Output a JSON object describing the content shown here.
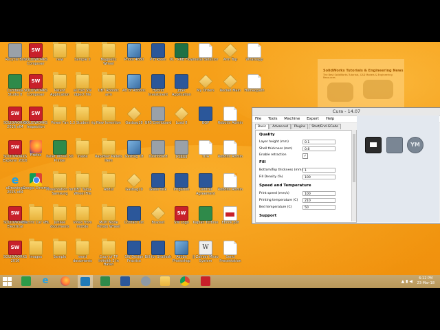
{
  "desktop": {
    "icons": [
      {
        "label": "Recycle Bin",
        "type": "gray"
      },
      {
        "label": "SOLIDWORKS Composer",
        "type": "sw"
      },
      {
        "label": "new",
        "type": "folder"
      },
      {
        "label": "Sample 2",
        "type": "folder"
      },
      {
        "label": "Magnetic Wheel",
        "type": "folder"
      },
      {
        "label": "Photo 4830",
        "type": "img"
      },
      {
        "label": "P 8 Room",
        "type": "word"
      },
      {
        "label": "01 - RKB Flow",
        "type": "excel"
      },
      {
        "label": "metal detector",
        "type": "doc"
      },
      {
        "label": "Arm Top",
        "type": "box"
      },
      {
        "label": "Whatsapp",
        "type": "doc"
      },
      {
        "label": "Camtasia Studio 8",
        "type": "green"
      },
      {
        "label": "SOLIDWORKS Composer",
        "type": "sw"
      },
      {
        "label": "Patent Application",
        "type": "folder"
      },
      {
        "label": "all fold SW object file",
        "type": "folder"
      },
      {
        "label": "UBT Robotic arm",
        "type": "folder"
      },
      {
        "label": "Att of Robotic",
        "type": "img"
      },
      {
        "label": "Hybrid Investment",
        "type": "word"
      },
      {
        "label": "JBSP Application",
        "type": "word"
      },
      {
        "label": "My Orders",
        "type": "box"
      },
      {
        "label": "Rocket Main",
        "type": "box"
      },
      {
        "label": "Homeopath",
        "type": "doc"
      },
      {
        "label": "SOLIDWORKS 2016 x64",
        "type": "sw"
      },
      {
        "label": "SOLIDWORKS Inspection",
        "type": "sw"
      },
      {
        "label": "Power Fan",
        "type": "folder"
      },
      {
        "label": "1.3 Student rig",
        "type": "folder"
      },
      {
        "label": "New Invention",
        "type": "folder"
      },
      {
        "label": "Gasbag18",
        "type": "box"
      },
      {
        "label": "GPS Dashboard",
        "type": "gray"
      },
      {
        "label": "Load 8",
        "type": "box"
      },
      {
        "label": "BGP",
        "type": "word"
      },
      {
        "label": "Robotic Admin",
        "type": "doc"
      },
      {
        "label": "SOLIDWORKS Explorer 2016",
        "type": "sw"
      },
      {
        "label": "Firefox",
        "type": "firefox"
      },
      {
        "label": "Pallet Wheel 3D Printer",
        "type": "green"
      },
      {
        "label": "Inside",
        "type": "folder"
      },
      {
        "label": "Rapidser Pallets Item",
        "type": "folder"
      },
      {
        "label": "Gasbag 18",
        "type": "img"
      },
      {
        "label": "Dashboard",
        "type": "gray"
      },
      {
        "label": "jkjjjjjjjjj",
        "type": "gray"
      },
      {
        "label": "TDA",
        "type": "doc"
      },
      {
        "label": "Robotic Admin",
        "type": "doc"
      },
      {
        "label": "eDrawings 2016 x64",
        "type": "ie-e"
      },
      {
        "label": "Google Chrome",
        "type": "chrome"
      },
      {
        "label": "Presentation for Samsung",
        "type": "folder"
      },
      {
        "label": "DBT Taiba Wheel File",
        "type": "folder"
      },
      {
        "label": "Abdul",
        "type": "folder"
      },
      {
        "label": "Gasbag19",
        "type": "box"
      },
      {
        "label": "Glass disk",
        "type": "word"
      },
      {
        "label": "Irrigation",
        "type": "word"
      },
      {
        "label": "Central Agreement",
        "type": "word"
      },
      {
        "label": "Robotic Admin",
        "type": "doc"
      },
      {
        "label": "SOLIDWORKS Electrical",
        "type": "sw"
      },
      {
        "label": "Electric Car VBL",
        "type": "folder"
      },
      {
        "label": "Jubilee documents",
        "type": "folder"
      },
      {
        "label": "Video from mobile",
        "type": "folder"
      },
      {
        "label": "Multi Mode Potato Wheel",
        "type": "folder"
      },
      {
        "label": "Contact list",
        "type": "word"
      },
      {
        "label": "Bracket",
        "type": "box"
      },
      {
        "label": "SW Logo",
        "type": "sw"
      },
      {
        "label": "Kaplan Turbine",
        "type": "green"
      },
      {
        "label": "Ebook.pdf",
        "type": "pdf"
      },
      {
        "label": "SOLIDWORKS 2016",
        "type": "sw"
      },
      {
        "label": "Images",
        "type": "folder"
      },
      {
        "label": "Sample",
        "type": "folder"
      },
      {
        "label": "word documents",
        "type": "folder"
      },
      {
        "label": "Copy of TP Infinitik 2 in Hafan",
        "type": "folder"
      },
      {
        "label": "SW Design Practice",
        "type": "word"
      },
      {
        "label": "Bill for Shailesh",
        "type": "word"
      },
      {
        "label": "Adobe Photoshop",
        "type": "img"
      },
      {
        "label": "JJ Zaheer Micro System",
        "type": "wiki"
      },
      {
        "label": "Send Presentation",
        "type": "doc"
      }
    ]
  },
  "banner": {
    "title": "SolidWorks Tutorials & Engineering News",
    "subtitle": "The Best SolidWorks Tutorials, CAD Models & Engineering Resources"
  },
  "cura": {
    "title": "Cura - 14.07",
    "menu": [
      "File",
      "Tools",
      "Machine",
      "Expert",
      "Help"
    ],
    "tabs": [
      "Basic",
      "Advanced",
      "Plugins",
      "Start/End-GCode"
    ],
    "active_tab": "Basic",
    "sections": {
      "quality": "Quality",
      "fill": "Fill",
      "speed": "Speed and Temperature",
      "support": "Support"
    },
    "fields": {
      "layer_height": {
        "label": "Layer height (mm)",
        "value": "0.1"
      },
      "shell_thickness": {
        "label": "Shell thickness (mm)",
        "value": "0.8"
      },
      "enable_retraction": {
        "label": "Enable retraction",
        "checked": "✓"
      },
      "bottom_top_thickness": {
        "label": "Bottom/Top thickness (mm)",
        "value": "1"
      },
      "fill_density": {
        "label": "Fill Density (%)",
        "value": "100"
      },
      "print_speed": {
        "label": "Print speed (mm/s)",
        "value": "100"
      },
      "printing_temperature": {
        "label": "Printing temperature (C)",
        "value": "210"
      },
      "bed_temperature": {
        "label": "Bed temperature (C)",
        "value": "50"
      }
    },
    "viewport_buttons": {
      "ym": "YM"
    }
  },
  "taskbar": {
    "time": "6:12 PM",
    "date": "23-Mar-18"
  }
}
